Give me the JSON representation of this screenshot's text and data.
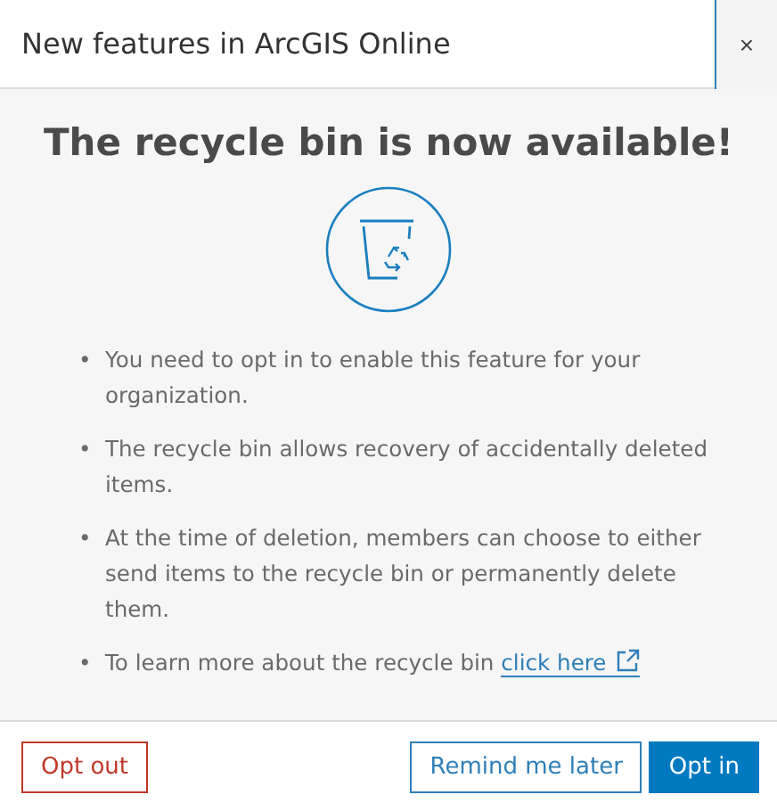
{
  "dialog": {
    "title": "New features in ArcGIS Online",
    "close_label": "×"
  },
  "heading": "The recycle bin is now available!",
  "bullet_marker": "•",
  "bullets": [
    {
      "text": "You need to opt in to enable this feature for your organization."
    },
    {
      "text": "The recycle bin allows recovery of accidentally deleted items."
    },
    {
      "text": "At the time of deletion, members can choose to either send items to the recycle bin or permanently delete them."
    },
    {
      "text": "To learn more about the recycle bin",
      "link": "click here"
    }
  ],
  "buttons": [
    {
      "label": "Opt out",
      "kind": "danger"
    },
    {
      "label": "Remind me later",
      "kind": "outline"
    },
    {
      "label": "Opt in",
      "kind": "primary"
    }
  ]
}
